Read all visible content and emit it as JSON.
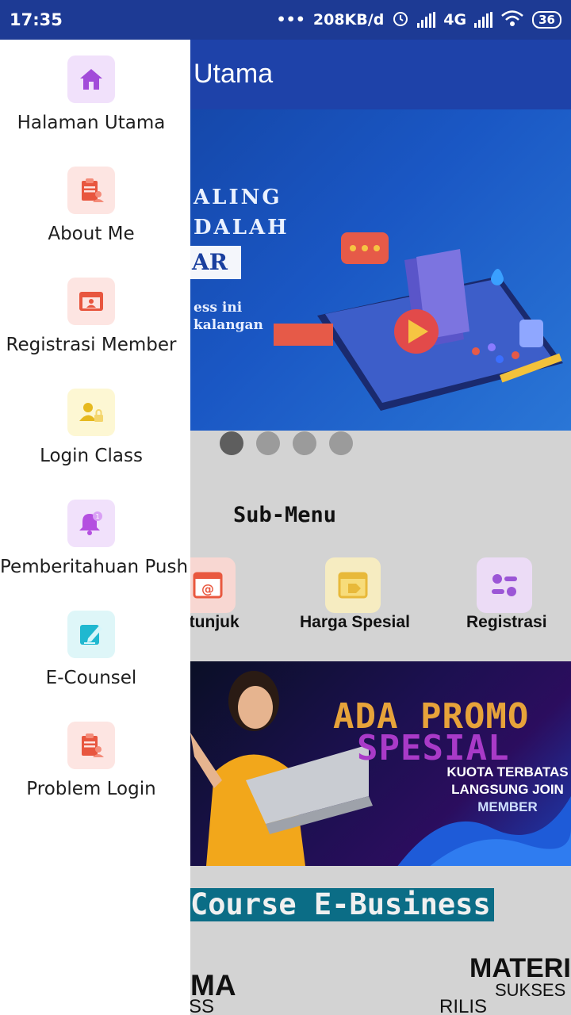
{
  "status_bar": {
    "time": "17:35",
    "dots": "•••",
    "speed": "208KB/d",
    "network": "4G",
    "battery": "36"
  },
  "app_bar": {
    "title": "Utama"
  },
  "hero": {
    "line1": "ALING",
    "line2": "DALAH",
    "line3": "AR",
    "line4": "ess ini",
    "line5": "kalangan"
  },
  "carousel": {
    "count": 4,
    "active_index": 0
  },
  "submenu": {
    "title": "Sub-Menu",
    "items": [
      {
        "label": "etunjuk",
        "icon": "at-sign-window-icon",
        "color": "#e9583f"
      },
      {
        "label": "Harga Spesial",
        "icon": "tag-window-icon",
        "color": "#e8b93a"
      },
      {
        "label": "Registrasi",
        "icon": "toggle-list-icon",
        "color": "#9b56d6"
      }
    ]
  },
  "promo": {
    "line1": "ADA PROMO",
    "line2": "SPESIAL",
    "line3": "KUOTA TERBATAS",
    "line4": "LANGSUNG JOIN",
    "line5": "MEMBER"
  },
  "course_banner": "Course E-Business",
  "bottom": {
    "left_text": "MA",
    "left_sub": "SS",
    "right_title": "MATERI",
    "right_sub1": "SUKSES",
    "right_sub2": "RILIS PRODUK"
  },
  "drawer": {
    "items": [
      {
        "label": "Halaman Utama",
        "icon": "home-icon",
        "bg": "#f1e1fb",
        "color": "#a24bd9"
      },
      {
        "label": "About Me",
        "icon": "clipboard-user-icon",
        "bg": "#fde5e2",
        "color": "#e8563f"
      },
      {
        "label": "Registrasi Member",
        "icon": "id-card-icon",
        "bg": "#fde5e2",
        "color": "#e8563f"
      },
      {
        "label": "Login Class",
        "icon": "user-lock-icon",
        "bg": "#fdf7d3",
        "color": "#e6b91f"
      },
      {
        "label": "Pemberitahuan Push",
        "icon": "bell-badge-icon",
        "bg": "#f1e1fb",
        "color": "#b44fe0"
      },
      {
        "label": "E-Counsel",
        "icon": "edit-note-icon",
        "bg": "#def6f8",
        "color": "#20b8d0"
      },
      {
        "label": "Problem Login",
        "icon": "clipboard-user-icon",
        "bg": "#fde5e2",
        "color": "#e8563f"
      }
    ]
  }
}
